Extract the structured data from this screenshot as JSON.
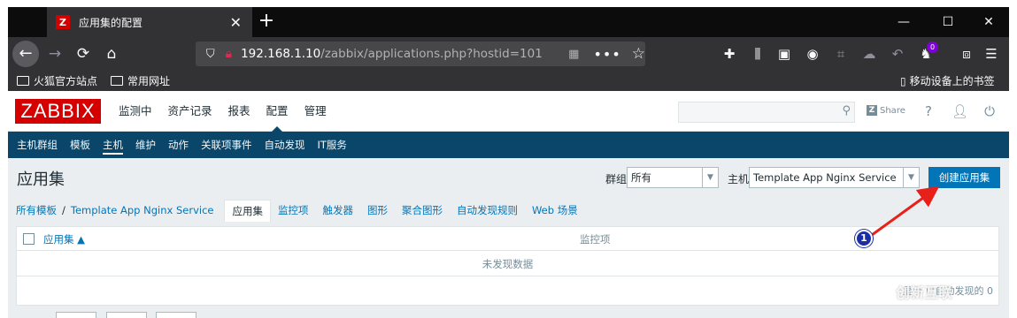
{
  "browser": {
    "tab_icon_letter": "Z",
    "tab_title": "应用集的配置",
    "tab_close": "✕",
    "new_tab": "+",
    "window_controls": {
      "minimize": "—",
      "maximize": "☐",
      "close": "✕"
    },
    "url_host": "192.168.1.10",
    "url_path": "/zabbix/applications.php?hostid=101",
    "page_actions": "•••",
    "bookmark_star": "☆",
    "toolbar_badge": "0",
    "bookmarks": [
      "火狐官方站点",
      "常用网址"
    ],
    "mobile_bookmarks": "移动设备上的书签"
  },
  "zabbix": {
    "logo": "ZABBIX",
    "main_menu": [
      "监测中",
      "资产记录",
      "报表",
      "配置",
      "管理"
    ],
    "share_label": "Share",
    "help": "?",
    "sub_menu": [
      "主机群组",
      "模板",
      "主机",
      "维护",
      "动作",
      "关联项事件",
      "自动发现",
      "IT服务"
    ],
    "page_title": "应用集",
    "filter": {
      "group_label": "群组",
      "group_value": "所有",
      "host_label": "主机",
      "host_value": "Template App Nginx Service"
    },
    "create_button": "创建应用集",
    "breadcrumb": {
      "all_templates": "所有模板",
      "separator": "/",
      "template": "Template App Nginx Service"
    },
    "tabs": [
      "应用集",
      "监控项",
      "触发器",
      "图形",
      "聚合图形",
      "自动发现规则",
      "Web 场景"
    ],
    "table": {
      "col_app": "应用集 ▲",
      "col_items": "监控项",
      "no_data": "未发现数据",
      "footer": "显示 已自动发现的 0"
    }
  },
  "annotation": {
    "marker_number": "1"
  },
  "watermark": "创新互联"
}
